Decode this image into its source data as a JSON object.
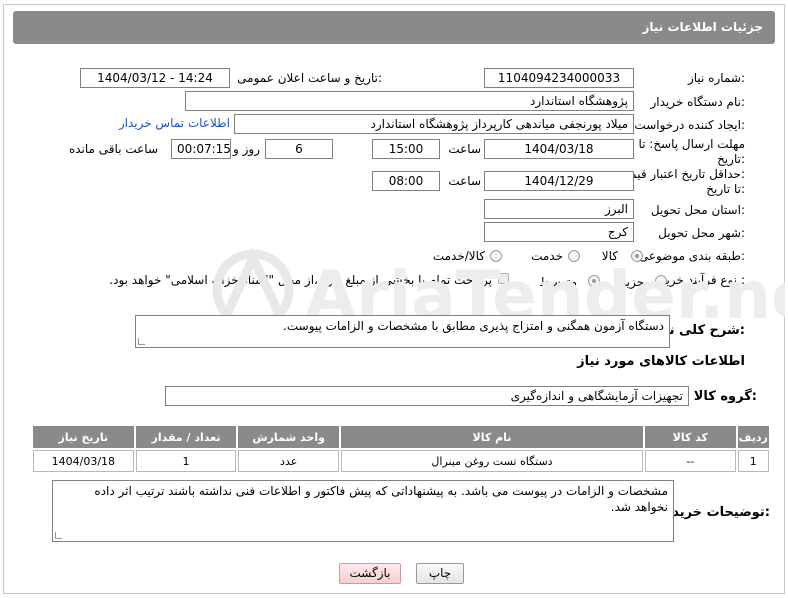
{
  "header": {
    "title": "جزئیات اطلاعات نیاز"
  },
  "fields": {
    "need_number_label": "شماره نیاز:",
    "need_number": "1104094234000033",
    "announce_label": "تاریخ و ساعت اعلان عمومی:",
    "announce_value": "1404/03/12 - 14:24",
    "buyer_org_label": "نام دستگاه خریدار:",
    "buyer_org": "پژوهشگاه استاندارد",
    "creator_label": "ایجاد کننده درخواست:",
    "creator": "میلاد پورنجفی میاندهی کارپرداز پژوهشگاه استاندارد",
    "contact_link": "اطلاعات تماس خریدار",
    "deadline_label_1": "مهلت ارسال پاسخ: تا",
    "deadline_label_2": "تاریخ:",
    "deadline_date": "1404/03/18",
    "time_label": "ساعت",
    "deadline_time": "15:00",
    "days_value": "6",
    "days_label": "روز و",
    "remaining_value": "00:07:15",
    "remaining_label": "ساعت باقی مانده",
    "price_label_1": "حداقل تاریخ اعتبار قیمت:",
    "price_label_2": "تا تاریخ:",
    "price_date": "1404/12/29",
    "price_time": "08:00",
    "province_label": "استان محل تحویل:",
    "province": "البرز",
    "city_label": "شهر محل تحویل:",
    "city": "کرج",
    "category_label": "طبقه بندی موضوعی:",
    "category_options": [
      "کالا",
      "خدمت",
      "کالا/خدمت"
    ],
    "process_label": "نوع فرآیند خرید :",
    "process_options": [
      "جزیی",
      "متوسط"
    ],
    "payment_note": "پرداخت تمام یا بخشی از مبلغ خرید،از محل \"اسناد خزانه اسلامی\" خواهد بود.",
    "desc_label": "شرح کلی نیاز:",
    "desc": "دستگاه آزمون همگنی و امتزاج پذیری مطابق با مشخصات و الزامات پیوست.",
    "items_heading": "اطلاعات کالاهای مورد نیاز",
    "goods_group_label": "گروه کالا:",
    "goods_group": "تجهیزات آزمایشگاهی و اندازه‌گیری",
    "buyer_notes_label": "توضیحات خریدار:",
    "buyer_notes": "مشخصات و الزامات در پیوست می باشد. به پیشنهاداتی که پیش فاکتور و اطلاعات فنی نداشته باشند ترتیب اثر داده نخواهد شد."
  },
  "table": {
    "headers": [
      "ردیف",
      "کد کالا",
      "نام کالا",
      "واحد شمارش",
      "تعداد / مقدار",
      "تاریخ نیاز"
    ],
    "rows": [
      [
        "1",
        "--",
        "دستگاه تست روغن مینرال",
        "عدد",
        "1",
        "1404/03/18"
      ]
    ]
  },
  "buttons": {
    "print": "چاپ",
    "back": "بازگشت"
  },
  "watermark_text": "AriaTender.net",
  "colors": {
    "header_bg": "#8a8a8a",
    "link": "#1a55c4",
    "back_btn": "#f7cfcf"
  }
}
